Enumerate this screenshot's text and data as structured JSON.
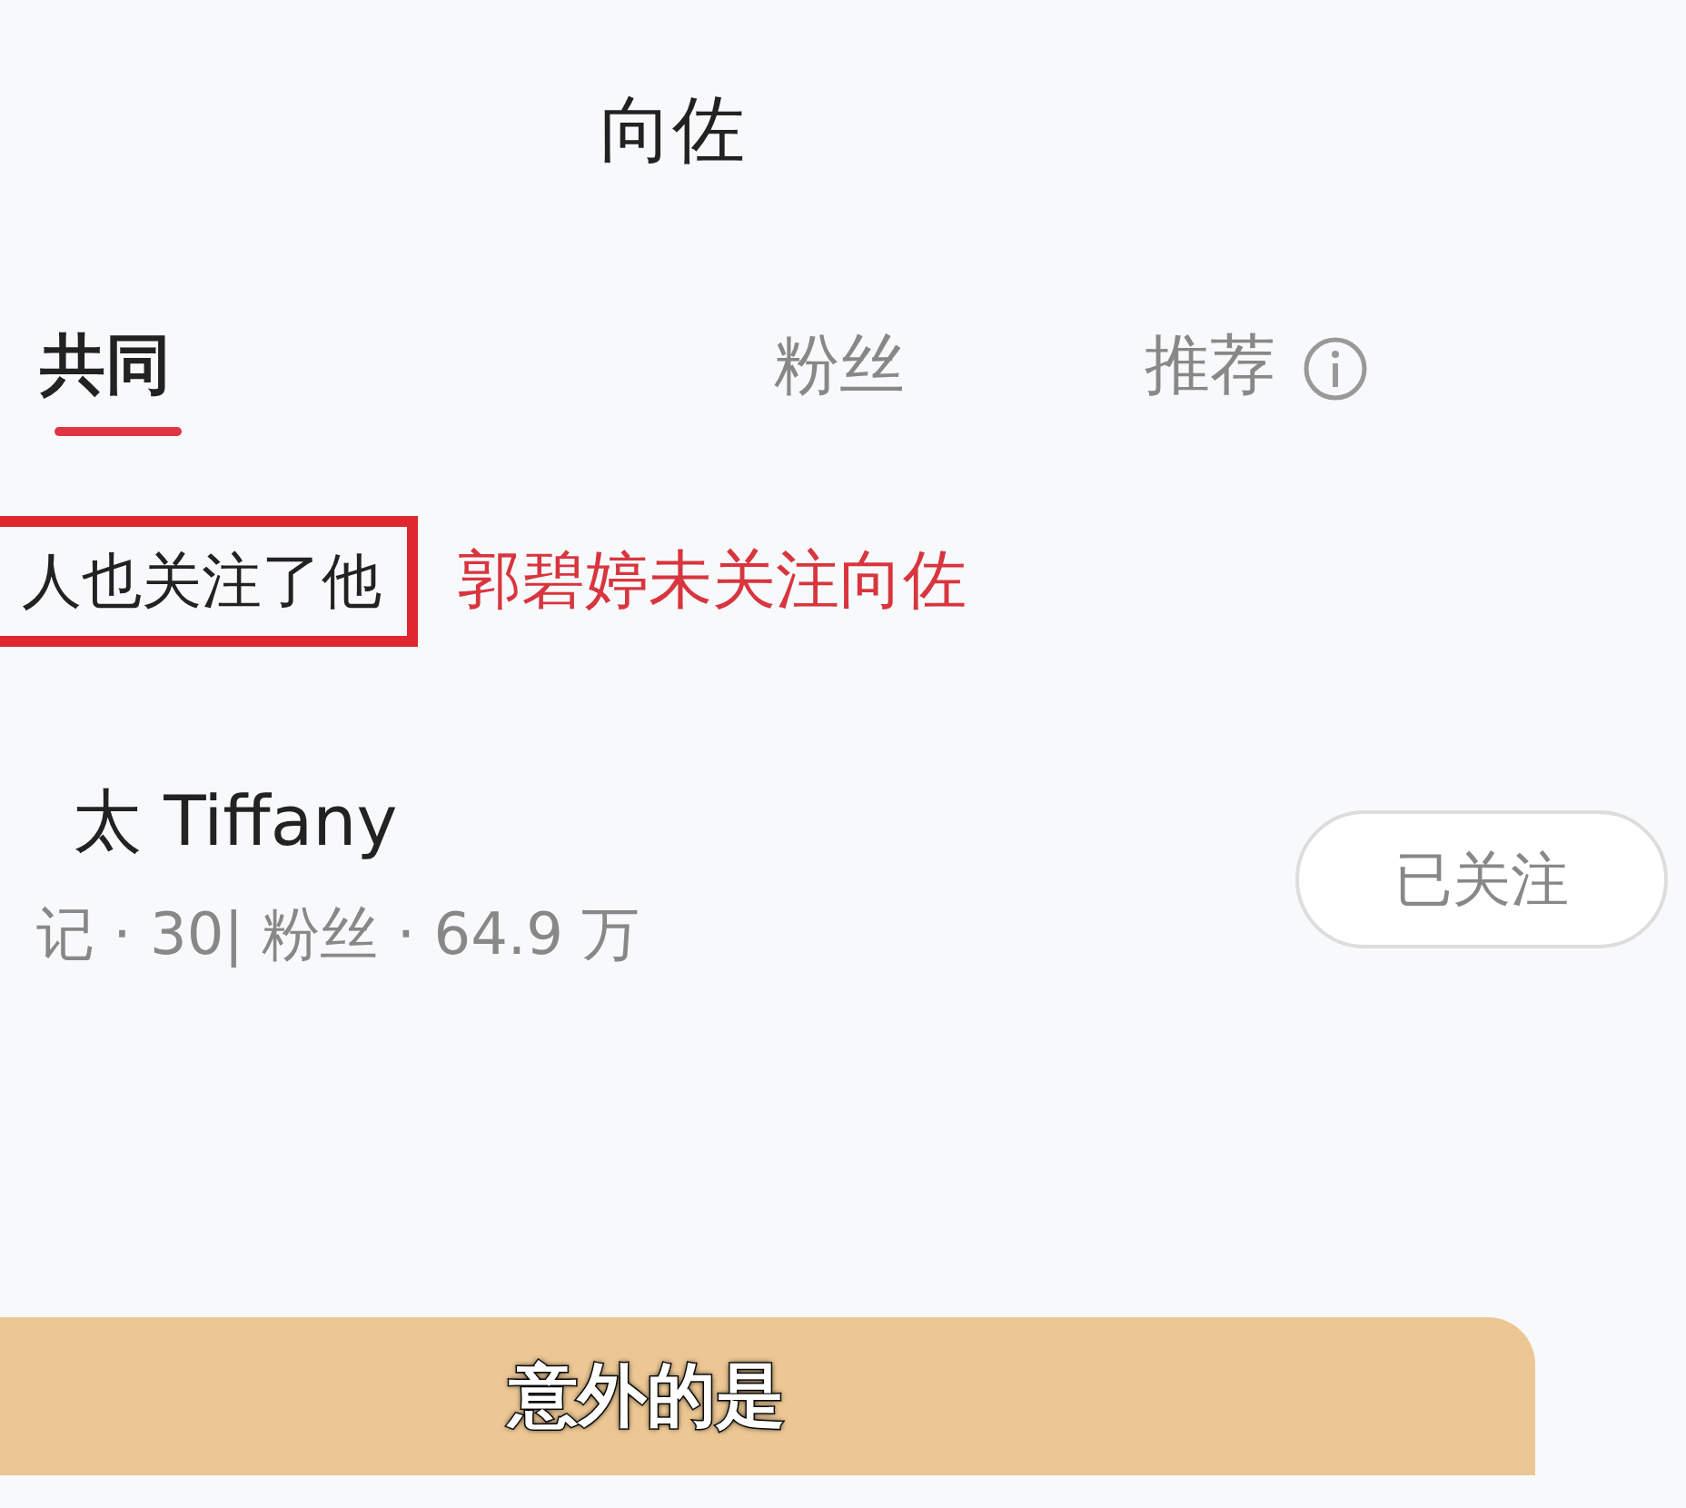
{
  "header": {
    "title": "向佐"
  },
  "tabs": [
    {
      "label": "共同",
      "selected": true,
      "info": false
    },
    {
      "label": "粉丝",
      "selected": false,
      "info": false
    },
    {
      "label": "推荐",
      "selected": false,
      "info": true
    }
  ],
  "section": {
    "label": "人也关注了他",
    "highlighted": true,
    "annotation": "郭碧婷未关注向佐"
  },
  "users": [
    {
      "name": "太 Tiffany",
      "stats": "记 · 30| 粉丝 · 64.9 万",
      "followed": true,
      "button": "已关注"
    }
  ],
  "subtitle": "意外的是"
}
